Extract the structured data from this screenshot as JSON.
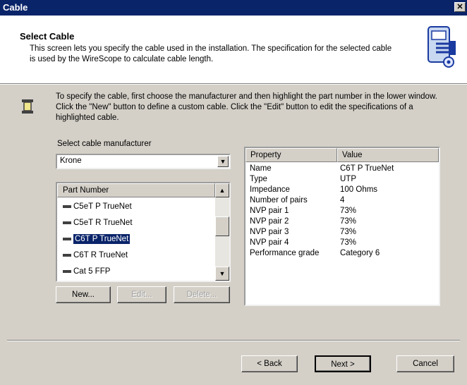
{
  "window": {
    "title": "Cable"
  },
  "header": {
    "title": "Select Cable",
    "description": "This screen lets you specify the cable used in the installation. The specification for the selected cable is used by the WireScope to calculate cable length."
  },
  "instructions": "To specify the cable, first choose the manufacturer and then highlight the part number in the lower window. Click the \"New\" button to define a custom cable. Click the \"Edit\" button to edit the specifications of a highlighted cable.",
  "manufacturer": {
    "label": "Select cable manufacturer",
    "value": "Krone"
  },
  "part_list": {
    "header": "Part Number",
    "items": [
      {
        "label": "C5eT P TrueNet"
      },
      {
        "label": "C5eT R TrueNet"
      },
      {
        "label": "C6T P TrueNet",
        "selected": true
      },
      {
        "label": "C6T R TrueNet"
      },
      {
        "label": "Cat 5 FFP"
      }
    ]
  },
  "list_buttons": {
    "new": "New...",
    "edit": "Edit...",
    "delete": "Delete..."
  },
  "properties": {
    "header_property": "Property",
    "header_value": "Value",
    "rows": [
      {
        "name": "Name",
        "value": "C6T P TrueNet"
      },
      {
        "name": "Type",
        "value": "UTP"
      },
      {
        "name": "Impedance",
        "value": "100 Ohms"
      },
      {
        "name": "Number of pairs",
        "value": "4"
      },
      {
        "name": "NVP pair 1",
        "value": "73%"
      },
      {
        "name": "NVP pair 2",
        "value": "73%"
      },
      {
        "name": "NVP pair 3",
        "value": "73%"
      },
      {
        "name": "NVP pair 4",
        "value": "73%"
      },
      {
        "name": "Performance grade",
        "value": "Category 6"
      }
    ]
  },
  "footer": {
    "back": "< Back",
    "next": "Next >",
    "cancel": "Cancel"
  }
}
